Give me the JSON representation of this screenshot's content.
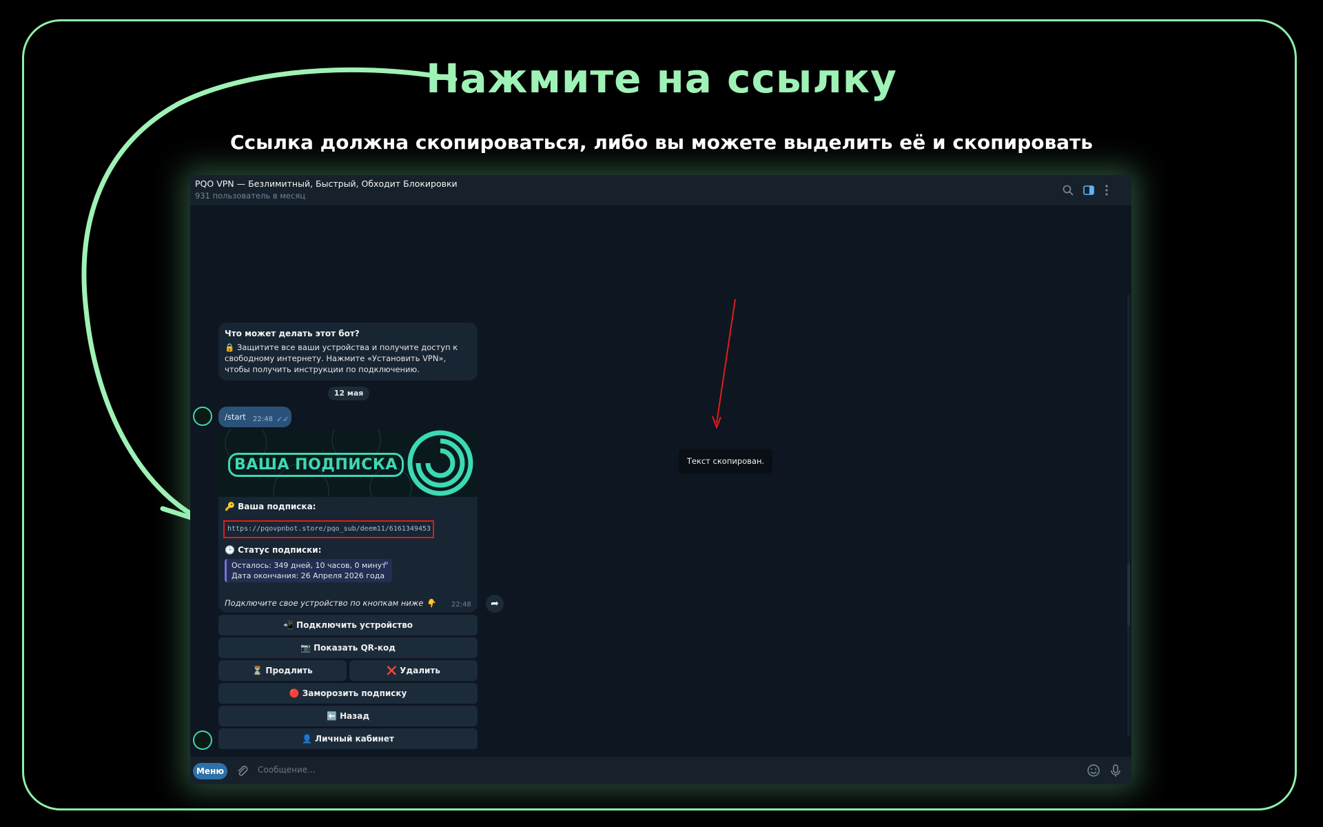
{
  "instruction": {
    "title": "Нажмите на ссылку",
    "subtitle": "Ссылка должна скопироваться, либо вы можете выделить её и скопировать"
  },
  "window": {
    "title": "PQO VPN — Безлимитный, Быстрый, Обходит Блокировки",
    "subtitle": "931 пользователь в месяц",
    "icons": [
      "search-icon",
      "sidebar-toggle-icon",
      "more-vertical-icon"
    ]
  },
  "chat": {
    "info_bubble": {
      "title": "Что может делать этот бот?",
      "text": "🔒 Защитите все ваши устройства и получите доступ к свободному интернету. Нажмите «Установить VPN», чтобы получить инструкции по подключению."
    },
    "date_pill": "12 мая",
    "start_message": {
      "text": "/start",
      "time": "22:48"
    },
    "bot_message": {
      "banner_title": "ВАША ПОДПИСКА",
      "subscription_label": "🔑 Ваша подписка:",
      "link": "https://pqovpnbot.store/pqo_sub/deem11/6161349453",
      "status_label": "🕒 Статус подписки:",
      "remaining": "Осталось: 349 дней, 10 часов, 0 минут",
      "expires": "Дата окончания: 26 Апреля 2026 года",
      "footer": "Подключите свое устройство по кнопкам ниже 👇",
      "time": "22:48"
    },
    "keyboard": {
      "connect": "📲 Подключить устройство",
      "qr": "📷 Показать QR-код",
      "extend": "⏳ Продлить",
      "delete": "❌ Удалить",
      "freeze": "🔴 Заморозить подписку",
      "back": "⬅️ Назад",
      "account": "👤 Личный кабинет"
    },
    "toast": "Текст скопирован."
  },
  "input": {
    "menu_label": "Меню",
    "placeholder": "Сообщение..."
  },
  "colors": {
    "accent_green": "#9ff2b6",
    "highlight_red": "#e51b1b",
    "tg_background": "#0e1621",
    "bubble": "#182533"
  }
}
